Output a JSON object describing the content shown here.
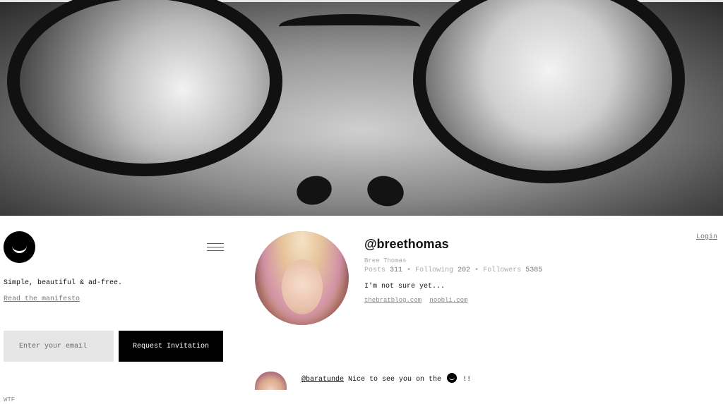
{
  "cover": {
    "alt": ""
  },
  "sidebar": {
    "tagline": "Simple, beautiful & ad-free.",
    "manifesto_link": "Read the manifesto",
    "email_placeholder": "Enter your email",
    "request_button": "Request Invitation",
    "footer_link": "WTF"
  },
  "header": {
    "login": "Login"
  },
  "profile": {
    "username": "@breethomas",
    "full_name": "Bree Thomas",
    "stats": {
      "posts_label": "Posts",
      "posts": "311",
      "following_label": "Following",
      "following": "202",
      "followers_label": "Followers",
      "followers": "5385",
      "separator": "•"
    },
    "bio": "I'm not sure yet...",
    "links": [
      "thebratblog.com",
      "noobli.com"
    ]
  },
  "post": {
    "mention": "@baratunde",
    "text": "Nice to see you on the",
    "suffix": "!!"
  },
  "icons": {
    "brand": "ello-smile-icon",
    "menu": "hamburger-menu-icon"
  }
}
